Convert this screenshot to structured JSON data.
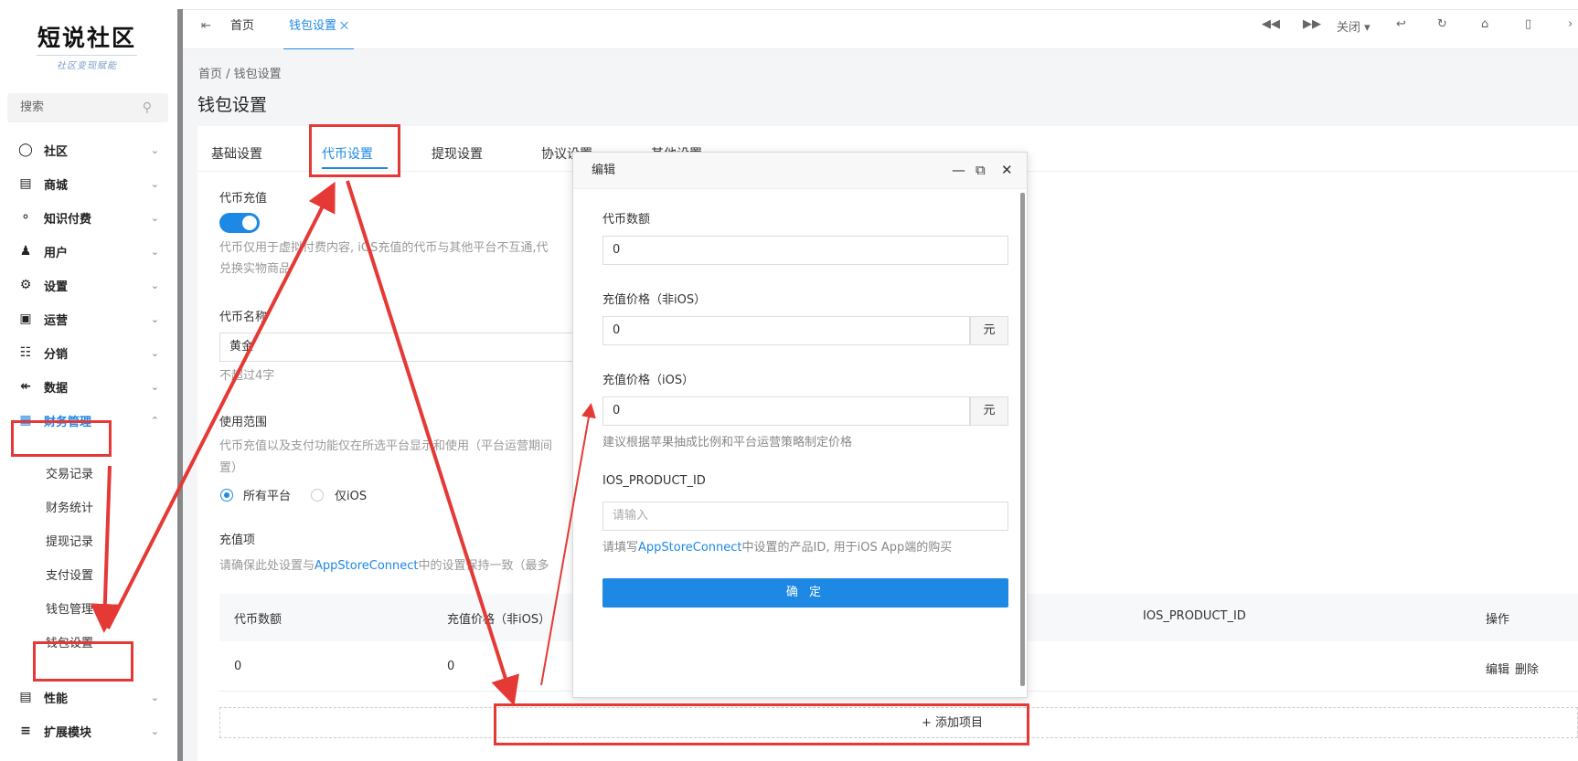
{
  "sidebar": {
    "logo_title": "短说社区",
    "logo_subtitle": "社区变现赋能",
    "search_placeholder": "搜索",
    "items": [
      {
        "label": "社区",
        "icon": "chat-icon"
      },
      {
        "label": "商城",
        "icon": "store-icon"
      },
      {
        "label": "知识付费",
        "icon": "bulb-icon"
      },
      {
        "label": "用户",
        "icon": "users-icon"
      },
      {
        "label": "设置",
        "icon": "gear-icon"
      },
      {
        "label": "运营",
        "icon": "monitor-icon"
      },
      {
        "label": "分销",
        "icon": "network-icon"
      },
      {
        "label": "数据",
        "icon": "chart-icon"
      },
      {
        "label": "财务管理",
        "icon": "wallet-icon"
      },
      {
        "label": "性能",
        "icon": "server-icon"
      },
      {
        "label": "扩展模块",
        "icon": "module-icon"
      }
    ],
    "finance_sub": [
      "交易记录",
      "财务统计",
      "提现记录",
      "支付设置",
      "钱包管理",
      "钱包设置"
    ]
  },
  "topbar": {
    "tab_home": "首页",
    "tab_wallet": "钱包设置",
    "close_label": "关闭"
  },
  "main": {
    "breadcrumb": "首页 / 钱包设置",
    "title": "钱包设置",
    "tabs": [
      "基础设置",
      "代币设置",
      "提现设置",
      "协议设置",
      "其他设置"
    ],
    "recharge_label": "代币充值",
    "recharge_help_1": "代币仅用于虚拟付费内容, iOS充值的代币与其他平台不互通,代",
    "recharge_help_2": "兑换实物商品",
    "name_label": "代币名称",
    "name_value": "黄金",
    "name_help": "不超过4字",
    "scope_label": "使用范围",
    "scope_help_1": "代币充值以及支付功能仅在所选平台显示和使用（平台运营期间",
    "scope_help_2": "置）",
    "scope_all": "所有平台",
    "scope_ios": "仅iOS",
    "items_label": "充值项",
    "items_help_prefix": "请确保此处设置与",
    "items_help_link": "AppStoreConnect",
    "items_help_suffix": "中的设置保持一致（最多",
    "table_headers": [
      "代币数额",
      "充值价格（非iOS）",
      "IOS_PRODUCT_ID",
      "操作"
    ],
    "table_row": {
      "amount": "0",
      "price": "0",
      "edit": "编辑",
      "delete": "删除"
    },
    "add_item": "+ 添加项目"
  },
  "modal": {
    "title": "编辑",
    "amount_label": "代币数额",
    "amount_value": "0",
    "price_label": "充值价格（非iOS）",
    "price_value": "0",
    "price_unit": "元",
    "ios_price_label": "充值价格（iOS）",
    "ios_price_value": "0",
    "ios_price_unit": "元",
    "ios_price_help": "建议根据苹果抽成比例和平台运营策略制定价格",
    "product_id_label": "IOS_PRODUCT_ID",
    "product_id_placeholder": "请输入",
    "product_help_prefix": "请填写",
    "product_help_link": "AppStoreConnect",
    "product_help_suffix": "中设置的产品ID, 用于iOS App端的购买",
    "submit": "确 定"
  },
  "colors": {
    "accent": "#1e88e5",
    "annotation": "#e53935"
  }
}
